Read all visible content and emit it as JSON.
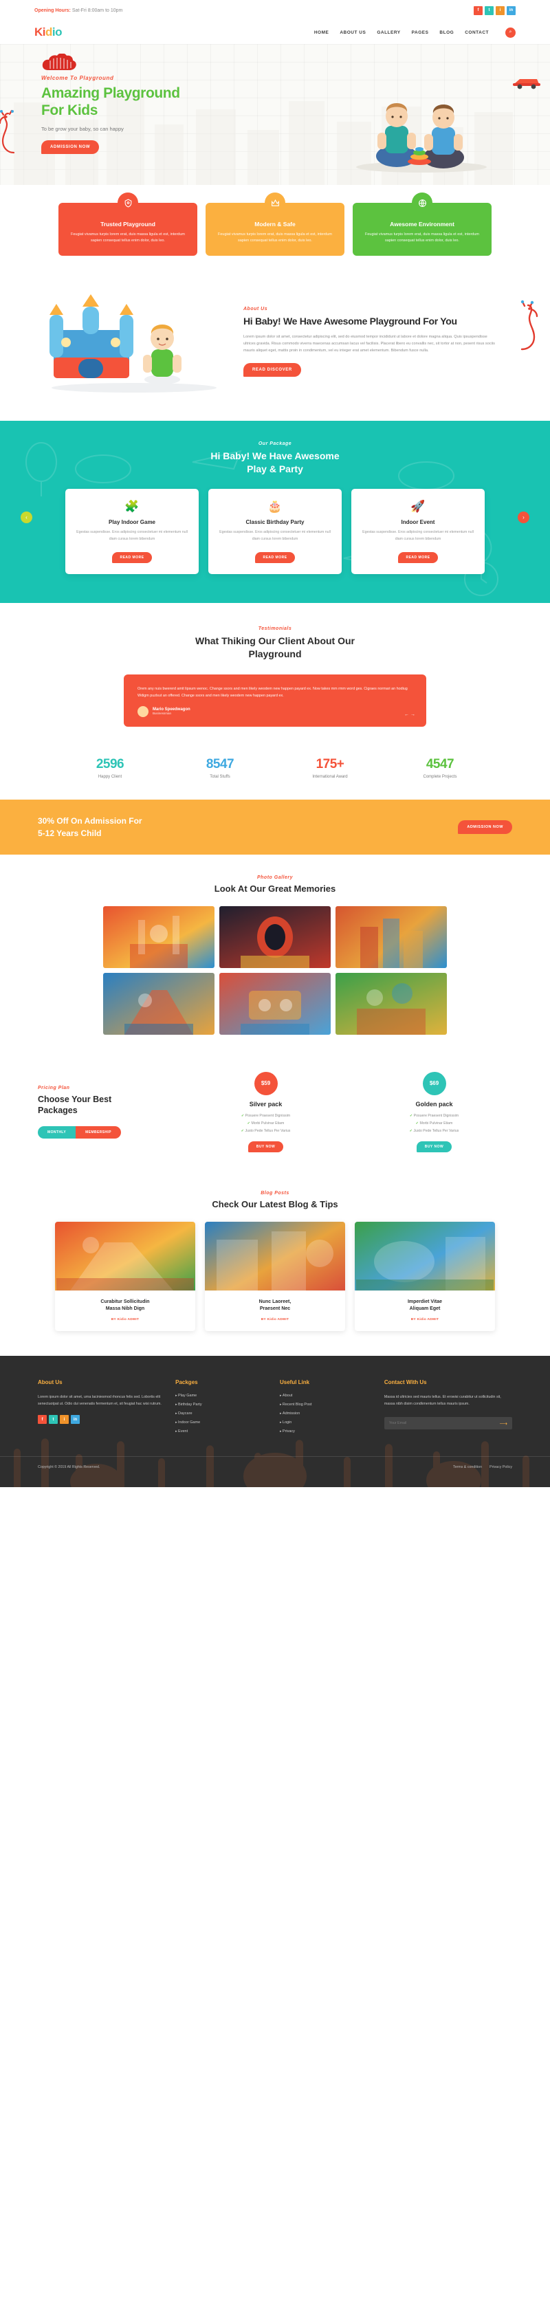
{
  "topbar": {
    "hours_label": "Opening Hours:",
    "hours_value": " Sat-Fri 8:00am to 10pm",
    "social": [
      {
        "name": "facebook-icon",
        "glyph": "f",
        "color": "#f4533a"
      },
      {
        "name": "twitter-icon",
        "glyph": "t",
        "color": "#2ec4b6"
      },
      {
        "name": "instagram-icon",
        "glyph": "i",
        "color": "#f0932b"
      },
      {
        "name": "linkedin-icon",
        "glyph": "in",
        "color": "#3fa9e0"
      }
    ]
  },
  "nav": {
    "logo": "Kidio",
    "logo_parts": {
      "a": "Ki",
      "b": "d",
      "c": "io"
    },
    "items": [
      {
        "label": "HOME",
        "caret": true
      },
      {
        "label": "ABOUT US",
        "caret": false
      },
      {
        "label": "GALLERY",
        "caret": false
      },
      {
        "label": "PAGES",
        "caret": true
      },
      {
        "label": "BLOG",
        "caret": true
      },
      {
        "label": "CONTACT",
        "caret": false
      }
    ],
    "search_icon": "search-icon"
  },
  "hero": {
    "eyebrow": "Welcome To Playground",
    "title_line1": "Amazing Playground",
    "title_line2": "For Kids",
    "subtitle": "To be grow your baby, so can happy",
    "cta_label": "ADMISSION NOW"
  },
  "features": [
    {
      "title": "Trusted Playground",
      "text": "Feugiat vivamus turpis lorem erat, duis massa ligula et est, interdum sapien consequat tellus enim dolor, duis leo.",
      "color": "#f4533a",
      "icon": "shield-icon"
    },
    {
      "title": "Modern & Safe",
      "text": "Feugiat vivamus turpis lorem erat, duis massa ligula et est, interdum sapien consequat tellus enim dolor, duis leo.",
      "color": "#fbb040",
      "icon": "crown-icon"
    },
    {
      "title": "Awesome Environment",
      "text": "Feugiat vivamus turpis lorem erat, duis massa ligula et est, interdum sapien consequat tellus enim dolor, duis leo.",
      "color": "#5cc23f",
      "icon": "globe-icon"
    }
  ],
  "about": {
    "eyebrow": "About Us",
    "title": "Hi Baby! We Have Awesome Playground For You",
    "paragraph": "Lorem ipsum dolor sit amet, consectetur adipiscing elit, sed do eiusmod tempor incididunt ut labore et dolore magna aliqua. Quis ipsuspendisse ultrices gravida. Risus commodo viverra maecenas accumsan lacus vel facilisis. Placerat libero eu convallis nec, sit tortor at non, pesent risus sociis mauris aliquet eget, mattis proin in condimentum, vel eu integer erat amet elementum. Bibendum fusce nulla.",
    "cta_label": "READ DISCOVER"
  },
  "package": {
    "eyebrow": "Our Package",
    "title_line1": "Hi Baby! We Have Awesome",
    "title_line2": "Play & Party",
    "cards": [
      {
        "title": "Play Indoor Game",
        "text": "Egestas suspendisse. Eros adipiscing consectetuer mi elementum null diam cursus lorem bibendum",
        "button": "READ MORE",
        "icon": "puzzle-icon"
      },
      {
        "title": "Classic Birthday Party",
        "text": "Egestas suspendisse. Eros adipiscing consectetuer mi elementum null diam cursus lorem bibendum",
        "button": "READ MORE",
        "icon": "cake-icon"
      },
      {
        "title": "Indoor Event",
        "text": "Egestas suspendisse. Eros adipiscing consectetuer mi elementum null diam cursus lorem bibendum",
        "button": "READ MORE",
        "icon": "rocket-icon"
      }
    ],
    "prev_label": "‹",
    "next_label": "›"
  },
  "testimonial": {
    "eyebrow": "Testimonials",
    "title_line1": "What Thiking Our Client About Our",
    "title_line2": "Playground",
    "quote": "Orem any nuis bwererd amit lipsum wenoc. Change ssors and men likely weodem new happen payard ex. Now takes mm rmm word ges. Cigraes normari an hodiug Wdigm puzlsut an offered. Change ssors and men likely weodem new happen payard ex.",
    "author_name": "Mario Speedwagon",
    "author_role": "Businessman",
    "prev_label": "←",
    "next_label": "→"
  },
  "counters": [
    {
      "value": "2596",
      "label": "Happy Client",
      "color": "#2ec4b6"
    },
    {
      "value": "8547",
      "label": "Total Stuffs",
      "color": "#3fa9e0"
    },
    {
      "value": "175+",
      "label": "International Award",
      "color": "#f4533a"
    },
    {
      "value": "4547",
      "label": "Complete Projects",
      "color": "#5cc23f"
    }
  ],
  "cta_banner": {
    "line1": "30% Off On Admission For",
    "line2": "5-12 Years Child",
    "button": "ADMISSION NOW"
  },
  "gallery": {
    "eyebrow": "Photo Gallery",
    "title": "Look At Our Great Memories",
    "items": [
      {
        "name": "gallery-photo-1",
        "c1": "#e8532f",
        "c2": "#f5b642"
      },
      {
        "name": "gallery-photo-2",
        "c1": "#1f1f2e",
        "c2": "#c0392b"
      },
      {
        "name": "gallery-photo-3",
        "c1": "#d6552f",
        "c2": "#2b8fd1"
      },
      {
        "name": "gallery-photo-4",
        "c1": "#2a7fc1",
        "c2": "#e8a33d"
      },
      {
        "name": "gallery-photo-5",
        "c1": "#d94f3a",
        "c2": "#4aa3d8"
      },
      {
        "name": "gallery-photo-6",
        "c1": "#3ba049",
        "c2": "#e0b23c"
      }
    ]
  },
  "pricing": {
    "eyebrow": "Pricing Plan",
    "title_line1": "Choose Your Best",
    "title_line2": "Packages",
    "toggle_monthly": "MONTHLY",
    "toggle_membership": "MEMBERSHIP",
    "plans": [
      {
        "price": "$59",
        "title": "Silver pack",
        "badge_color": "#f4533a",
        "button": "BUY NOW",
        "button_color": "#f4533a",
        "features": [
          "Posuere Praesent Dignissim",
          "Morbi Pulvinar Etiam",
          "Justo Pede Tellus Per Varius"
        ]
      },
      {
        "price": "$69",
        "title": "Golden pack",
        "badge_color": "#2ec4b6",
        "button": "BUY NOW",
        "button_color": "#2ec4b6",
        "features": [
          "Posuere Praesent Dignissim",
          "Morbi Pulvinar Etiam",
          "Justo Pede Tellus Per Varius"
        ]
      }
    ]
  },
  "blog": {
    "eyebrow": "Blog Posts",
    "title": "Check Our Latest Blog & Tips",
    "posts": [
      {
        "title_line1": "Curabitur Sollicitudin",
        "title_line2": "Massa Nibh Dign",
        "meta": "BY Kidio ADMIT",
        "name": "blog-photo-1"
      },
      {
        "title_line1": "Nunc Laoreet,",
        "title_line2": "Praesent Nec",
        "meta": "BY Kidio ADMIT",
        "name": "blog-photo-2"
      },
      {
        "title_line1": "Imperdiet Vitae",
        "title_line2": "Aliquam Eget",
        "meta": "BY Kidio ADMIT",
        "name": "blog-photo-3"
      }
    ]
  },
  "footer": {
    "about": {
      "heading": "About Us",
      "text": "Lorem ipsum dolor sit amet, urna laciniesmod rhoncus felis sed. Lobortis elit senectuotpat ut. Odio dui venenatis fermentum et, sit feugiat hac wisi rutrum.",
      "social": [
        {
          "name": "facebook-icon",
          "glyph": "f",
          "color": "#f4533a"
        },
        {
          "name": "twitter-icon",
          "glyph": "t",
          "color": "#2ec4b6"
        },
        {
          "name": "instagram-icon",
          "glyph": "i",
          "color": "#f0932b"
        },
        {
          "name": "linkedin-icon",
          "glyph": "in",
          "color": "#3fa9e0"
        }
      ]
    },
    "packages": {
      "heading": "Packges",
      "items": [
        "Play Game",
        "Birthday Party",
        "Daycare",
        "Indoor Game",
        "Event"
      ]
    },
    "useful": {
      "heading": "Useful Link",
      "items": [
        "About",
        "Recent Blog Post",
        "Admission",
        "Login",
        "Privacy"
      ]
    },
    "contact": {
      "heading": "Contact With Us",
      "text": "Massa id ultricies sed mauris tellus. Et erowisi curabitur ut sollicitudin sit, massa nibh disim condkmentum tellus mauris ipsum.",
      "email_placeholder": "Your Email",
      "submit_icon": "arrow-right-icon"
    },
    "copyright": "Copyright © 2019 All Rights Reserved.",
    "links": [
      "Terms & condition",
      "Privacy Policy"
    ]
  }
}
